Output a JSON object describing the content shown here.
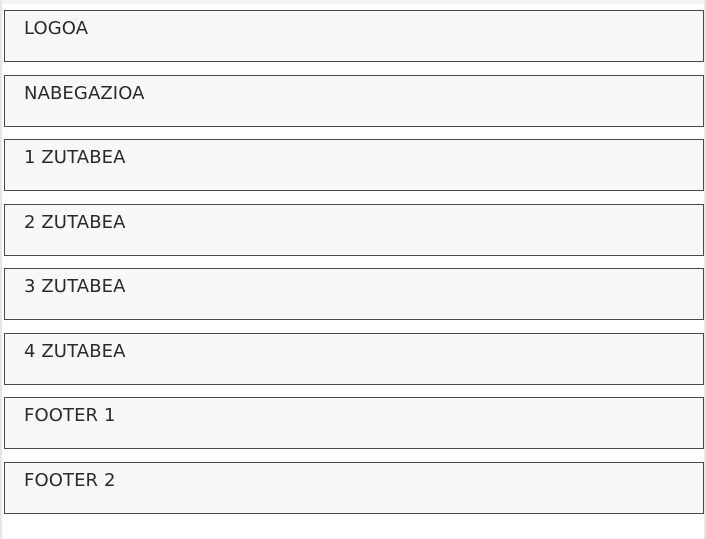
{
  "blocks": [
    {
      "label": "LOGOA"
    },
    {
      "label": "NABEGAZIOA"
    },
    {
      "label": "1 ZUTABEA"
    },
    {
      "label": "2 ZUTABEA"
    },
    {
      "label": "3 ZUTABEA"
    },
    {
      "label": "4 ZUTABEA"
    },
    {
      "label": "FOOTER 1"
    },
    {
      "label": "FOOTER 2"
    }
  ]
}
